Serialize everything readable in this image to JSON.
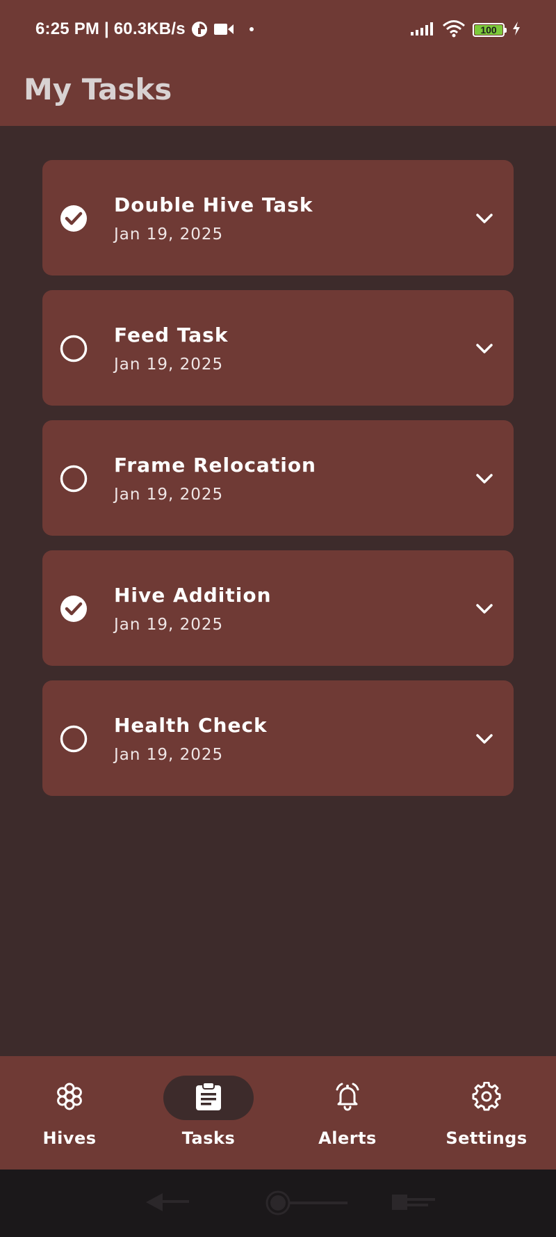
{
  "status_bar": {
    "time_speed": "6:25 PM | 60.3KB/s",
    "battery": "100"
  },
  "app_bar": {
    "title": "My Tasks"
  },
  "tasks": [
    {
      "title": "Double Hive Task",
      "date": "Jan 19, 2025",
      "completed": true
    },
    {
      "title": "Feed Task",
      "date": "Jan 19, 2025",
      "completed": false
    },
    {
      "title": "Frame Relocation",
      "date": "Jan 19, 2025",
      "completed": false
    },
    {
      "title": "Hive Addition",
      "date": "Jan 19, 2025",
      "completed": true
    },
    {
      "title": "Health Check",
      "date": "Jan 19, 2025",
      "completed": false
    }
  ],
  "bottom_nav": {
    "items": [
      {
        "label": "Hives",
        "icon": "hive-icon",
        "active": false
      },
      {
        "label": "Tasks",
        "icon": "clipboard-icon",
        "active": true
      },
      {
        "label": "Alerts",
        "icon": "bell-icon",
        "active": false
      },
      {
        "label": "Settings",
        "icon": "gear-icon",
        "active": false
      }
    ]
  },
  "colors": {
    "app_bar": "#6f3a35",
    "background": "#3d2b2b",
    "card": "#6f3a35",
    "system_nav": "#1b181a"
  }
}
